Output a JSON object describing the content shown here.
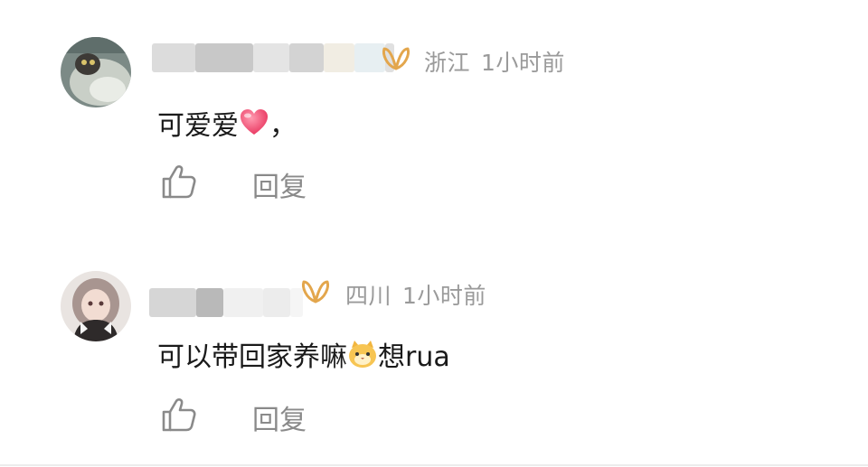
{
  "comments": [
    {
      "region": "浙江",
      "time": "1小时前",
      "text_before": "可爱爱",
      "emoji": "heart-emoji",
      "text_after": "，",
      "reply_label": "回复"
    },
    {
      "region": "四川",
      "time": "1小时前",
      "text_before": "可以带回家养嘛",
      "emoji": "cat-face-emoji",
      "text_after": "想rua",
      "reply_label": "回复"
    }
  ],
  "icons": {
    "like": "thumbs-up-icon",
    "vip": "vip-badge-icon"
  },
  "colors": {
    "vip_gold": "#e3a64c",
    "meta_gray": "#9a9a9a",
    "text": "#1a1a1a"
  }
}
